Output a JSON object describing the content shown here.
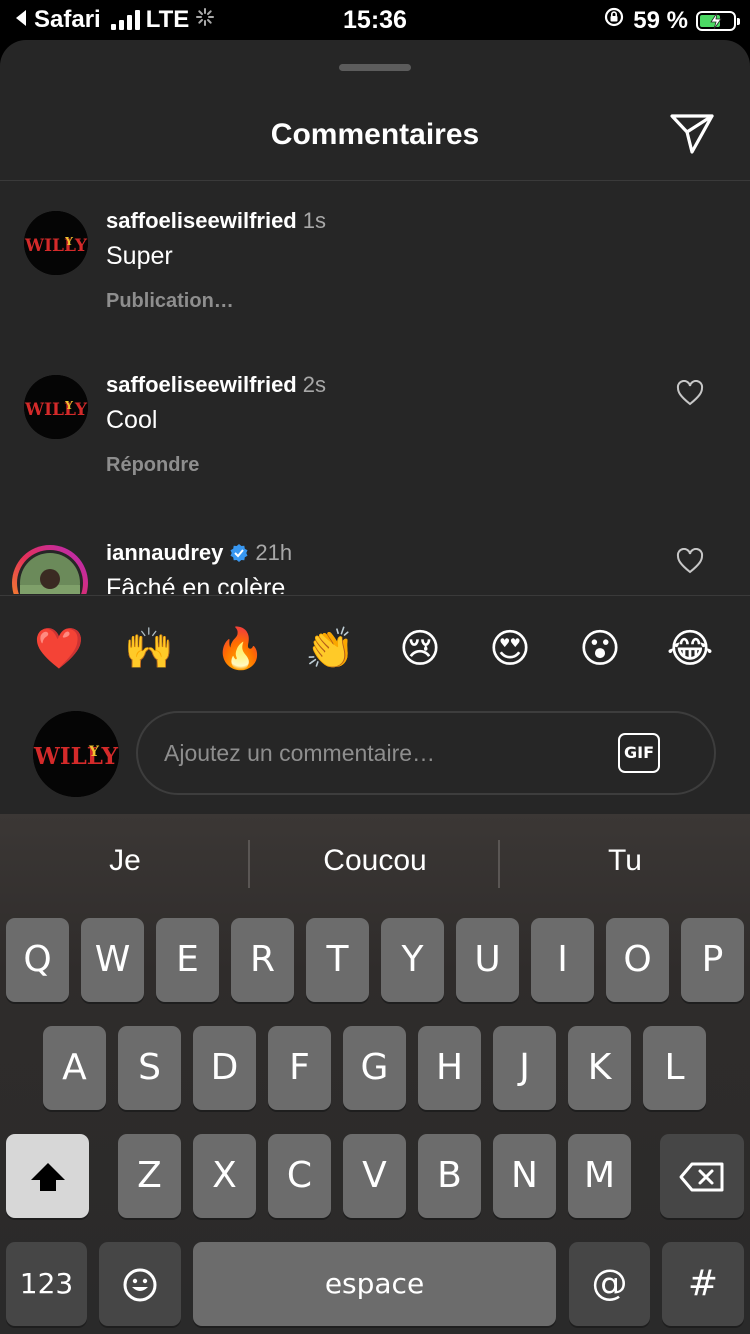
{
  "status_bar": {
    "back_app": "Safari",
    "network": "LTE",
    "time": "15:36",
    "battery_percent": "59 %",
    "battery_level": 0.59
  },
  "header": {
    "title": "Commentaires"
  },
  "comments": [
    {
      "username": "saffoeliseewilfried",
      "time": "1s",
      "text": "Super",
      "action": "Publication…",
      "verified": false,
      "liked": false
    },
    {
      "username": "saffoeliseewilfried",
      "time": "2s",
      "text": "Cool",
      "action": "Répondre",
      "verified": false,
      "liked": false
    },
    {
      "username": "iannaudrey",
      "time": "21h",
      "text": "Fâché en colère",
      "action": "",
      "verified": true,
      "liked": false
    }
  ],
  "emoji_bar": [
    "❤️",
    "🙌",
    "🔥",
    "👏",
    "😢",
    "😍",
    "😮",
    "😂"
  ],
  "composer": {
    "placeholder": "Ajoutez un commentaire…",
    "gif_label": "GIF"
  },
  "keyboard": {
    "predictions": [
      "Je",
      "Coucou",
      "Tu"
    ],
    "row1": [
      "Q",
      "W",
      "E",
      "R",
      "T",
      "Y",
      "U",
      "I",
      "O",
      "P"
    ],
    "row2": [
      "A",
      "S",
      "D",
      "F",
      "G",
      "H",
      "J",
      "K",
      "L"
    ],
    "row3": [
      "Z",
      "X",
      "C",
      "V",
      "B",
      "N",
      "M"
    ],
    "numbers_key": "123",
    "space_key": "espace",
    "at_key": "@",
    "hash_key": "#"
  },
  "colors": {
    "sheet_bg": "#262626",
    "secondary_text": "#a8a8a8",
    "verified_blue": "#3897f0",
    "key_bg": "#6c6c6c"
  }
}
